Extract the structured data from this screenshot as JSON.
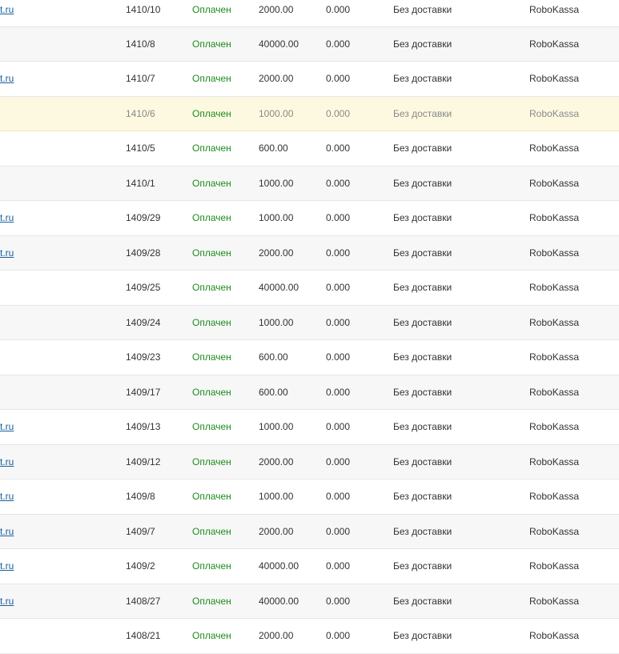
{
  "orders": {
    "rows": [
      {
        "email": "t.ru",
        "number": "1410/10",
        "status": "Оплачен",
        "sum": "2000.00",
        "delivery_sum": "0.000",
        "delivery": "Без доставки",
        "payment": "RoboKassa"
      },
      {
        "email": "",
        "number": "1410/8",
        "status": "Оплачен",
        "sum": "40000.00",
        "delivery_sum": "0.000",
        "delivery": "Без доставки",
        "payment": "RoboKassa"
      },
      {
        "email": "t.ru",
        "number": "1410/7",
        "status": "Оплачен",
        "sum": "2000.00",
        "delivery_sum": "0.000",
        "delivery": "Без доставки",
        "payment": "RoboKassa"
      },
      {
        "email": "",
        "number": "1410/6",
        "status": "Оплачен",
        "sum": "1000.00",
        "delivery_sum": "0.000",
        "delivery": "Без доставки",
        "payment": "RoboKassa"
      },
      {
        "email": "",
        "number": "1410/5",
        "status": "Оплачен",
        "sum": "600.00",
        "delivery_sum": "0.000",
        "delivery": "Без доставки",
        "payment": "RoboKassa"
      },
      {
        "email": "",
        "number": "1410/1",
        "status": "Оплачен",
        "sum": "1000.00",
        "delivery_sum": "0.000",
        "delivery": "Без доставки",
        "payment": "RoboKassa"
      },
      {
        "email": "t.ru",
        "number": "1409/29",
        "status": "Оплачен",
        "sum": "1000.00",
        "delivery_sum": "0.000",
        "delivery": "Без доставки",
        "payment": "RoboKassa"
      },
      {
        "email": "t.ru",
        "number": "1409/28",
        "status": "Оплачен",
        "sum": "2000.00",
        "delivery_sum": "0.000",
        "delivery": "Без доставки",
        "payment": "RoboKassa"
      },
      {
        "email": "",
        "number": "1409/25",
        "status": "Оплачен",
        "sum": "40000.00",
        "delivery_sum": "0.000",
        "delivery": "Без доставки",
        "payment": "RoboKassa"
      },
      {
        "email": "",
        "number": "1409/24",
        "status": "Оплачен",
        "sum": "1000.00",
        "delivery_sum": "0.000",
        "delivery": "Без доставки",
        "payment": "RoboKassa"
      },
      {
        "email": "",
        "number": "1409/23",
        "status": "Оплачен",
        "sum": "600.00",
        "delivery_sum": "0.000",
        "delivery": "Без доставки",
        "payment": "RoboKassa"
      },
      {
        "email": "",
        "number": "1409/17",
        "status": "Оплачен",
        "sum": "600.00",
        "delivery_sum": "0.000",
        "delivery": "Без доставки",
        "payment": "RoboKassa"
      },
      {
        "email": "t.ru",
        "number": "1409/13",
        "status": "Оплачен",
        "sum": "1000.00",
        "delivery_sum": "0.000",
        "delivery": "Без доставки",
        "payment": "RoboKassa"
      },
      {
        "email": "t.ru",
        "number": "1409/12",
        "status": "Оплачен",
        "sum": "2000.00",
        "delivery_sum": "0.000",
        "delivery": "Без доставки",
        "payment": "RoboKassa"
      },
      {
        "email": "t.ru",
        "number": "1409/8",
        "status": "Оплачен",
        "sum": "1000.00",
        "delivery_sum": "0.000",
        "delivery": "Без доставки",
        "payment": "RoboKassa"
      },
      {
        "email": "t.ru",
        "number": "1409/7",
        "status": "Оплачен",
        "sum": "2000.00",
        "delivery_sum": "0.000",
        "delivery": "Без доставки",
        "payment": "RoboKassa"
      },
      {
        "email": "t.ru",
        "number": "1409/2",
        "status": "Оплачен",
        "sum": "40000.00",
        "delivery_sum": "0.000",
        "delivery": "Без доставки",
        "payment": "RoboKassa"
      },
      {
        "email": "t.ru",
        "number": "1408/27",
        "status": "Оплачен",
        "sum": "40000.00",
        "delivery_sum": "0.000",
        "delivery": "Без доставки",
        "payment": "RoboKassa"
      },
      {
        "email": "",
        "number": "1408/21",
        "status": "Оплачен",
        "sum": "2000.00",
        "delivery_sum": "0.000",
        "delivery": "Без доставки",
        "payment": "RoboKassa"
      }
    ],
    "highlighted_row": 3
  },
  "colors": {
    "link": "#1a5f9e",
    "status_paid": "#1e8a1e",
    "row_alt_background": "#f7f7f7",
    "row_highlight_background": "#fdf9e1"
  }
}
